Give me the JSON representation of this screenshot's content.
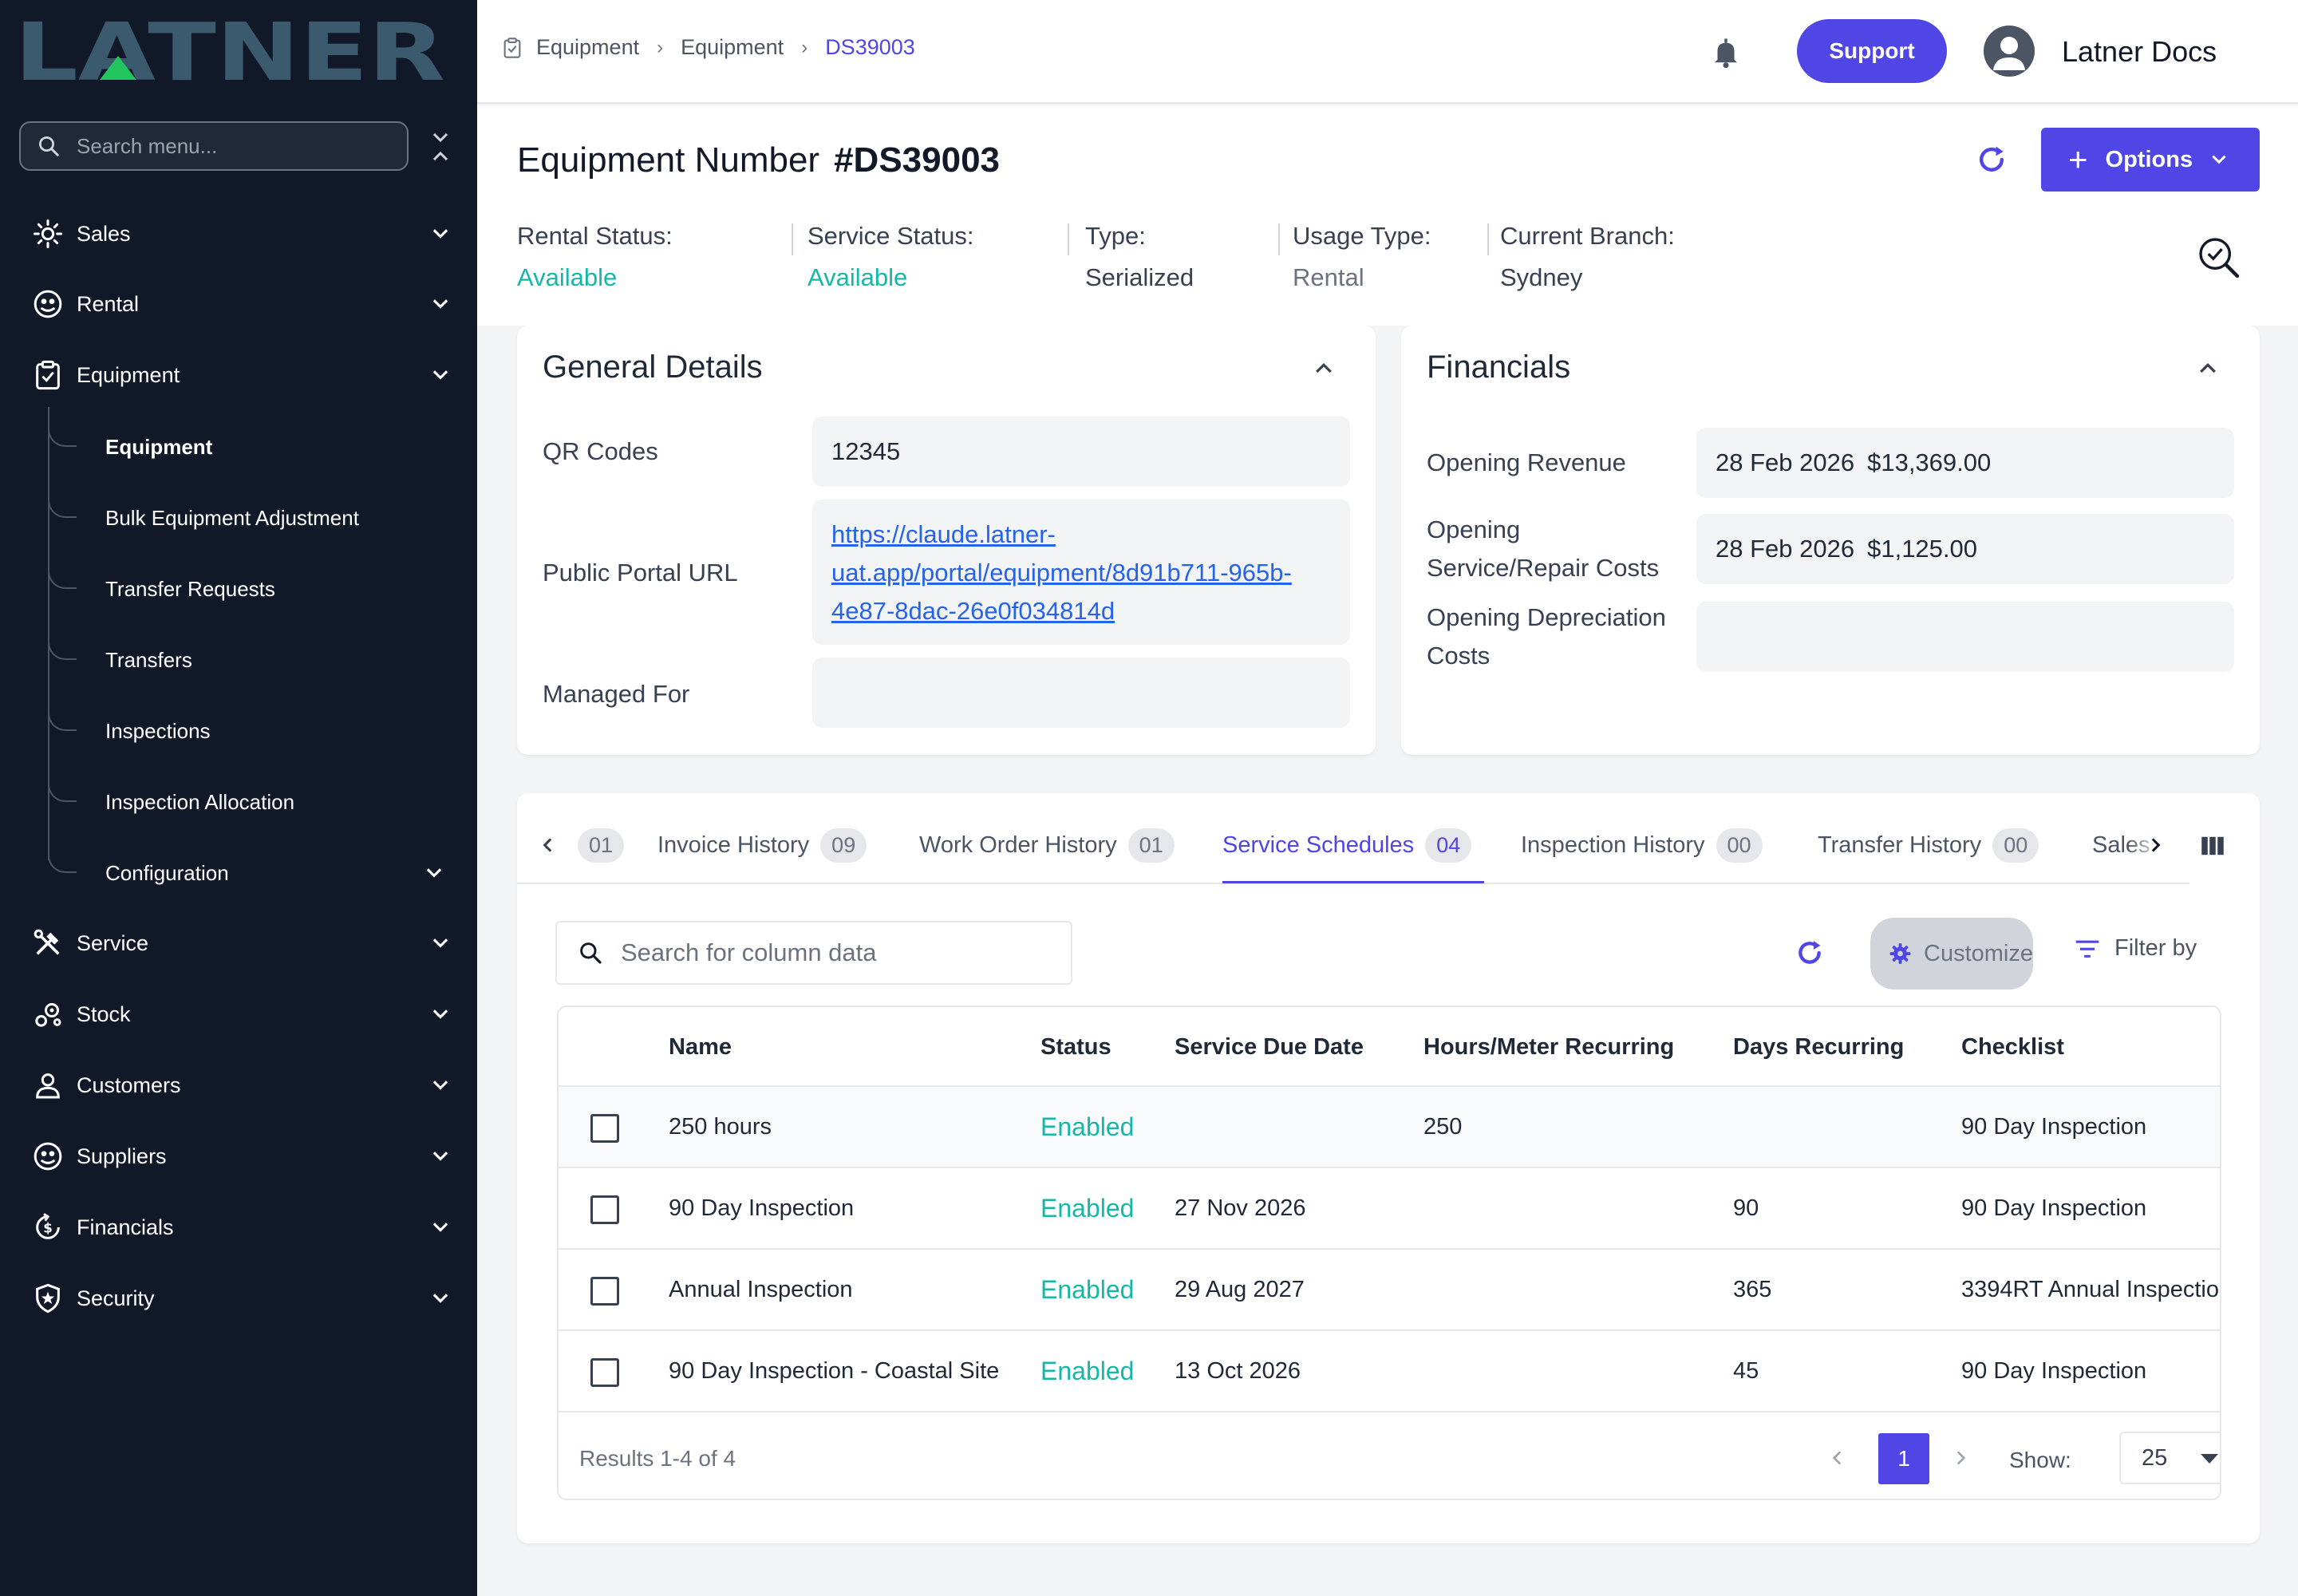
{
  "brand": {
    "logo_text": "LATNER"
  },
  "sidebar": {
    "search_placeholder": "Search menu...",
    "items": [
      {
        "label": "Sales",
        "icon": "sales-icon"
      },
      {
        "label": "Rental",
        "icon": "rental-icon"
      },
      {
        "label": "Equipment",
        "icon": "equipment-icon"
      },
      {
        "label": "Service",
        "icon": "service-icon"
      },
      {
        "label": "Stock",
        "icon": "stock-icon"
      },
      {
        "label": "Customers",
        "icon": "customers-icon"
      },
      {
        "label": "Suppliers",
        "icon": "suppliers-icon"
      },
      {
        "label": "Financials",
        "icon": "financials-icon"
      },
      {
        "label": "Security",
        "icon": "security-icon"
      }
    ],
    "equipment_sub": [
      {
        "label": "Equipment",
        "active": true
      },
      {
        "label": "Bulk Equipment Adjustment"
      },
      {
        "label": "Transfer Requests"
      },
      {
        "label": "Transfers"
      },
      {
        "label": "Inspections"
      },
      {
        "label": "Inspection Allocation"
      },
      {
        "label": "Configuration"
      }
    ]
  },
  "topbar": {
    "breadcrumb": [
      "Equipment",
      "Equipment",
      "DS39003"
    ],
    "support_label": "Support",
    "user_name": "Latner Docs"
  },
  "header": {
    "title_prefix": "Equipment Number",
    "equipment_number": "#DS39003",
    "options_label": "Options",
    "statuses": [
      {
        "label": "Rental Status:",
        "value": "Available",
        "color": "#14b8a6"
      },
      {
        "label": "Service Status:",
        "value": "Available",
        "color": "#14b8a6"
      },
      {
        "label": "Type:",
        "value": "Serialized",
        "color": "#374151"
      },
      {
        "label": "Usage Type:",
        "value": "Rental",
        "color": "#6b7280"
      },
      {
        "label": "Current Branch:",
        "value": "Sydney",
        "color": "#374151"
      }
    ]
  },
  "general": {
    "title": "General Details",
    "qr_label": "QR Codes",
    "qr_value": "12345",
    "portal_label": "Public Portal URL",
    "portal_url_lines": [
      "https://claude.latner-",
      "uat.app/portal/equipment/8d91b711-965b-",
      "4e87-8dac-26e0f034814d"
    ],
    "managed_label": "Managed For",
    "managed_value": ""
  },
  "financials": {
    "title": "Financials",
    "rows": [
      {
        "label_lines": [
          "Opening Revenue"
        ],
        "date": "28 Feb 2026",
        "amount": "$13,369.00"
      },
      {
        "label_lines": [
          "Opening",
          "Service/Repair Costs"
        ],
        "date": "28 Feb 2026",
        "amount": "$1,125.00"
      },
      {
        "label_lines": [
          "Opening Depreciation",
          "Costs"
        ],
        "date": "",
        "amount": ""
      }
    ]
  },
  "tabs": {
    "items": [
      {
        "label": "",
        "count": "01"
      },
      {
        "label": "Invoice History",
        "count": "09"
      },
      {
        "label": "Work Order History",
        "count": "01"
      },
      {
        "label": "Service Schedules",
        "count": "04",
        "active": true
      },
      {
        "label": "Inspection History",
        "count": "00"
      },
      {
        "label": "Transfer History",
        "count": "00"
      },
      {
        "label": "Sales",
        "count": ""
      }
    ]
  },
  "table": {
    "search_placeholder": "Search for column data",
    "customize_label": "Customize",
    "filter_label": "Filter by",
    "columns": [
      "Name",
      "Status",
      "Service Due Date",
      "Hours/Meter Recurring",
      "Days Recurring",
      "Checklist"
    ],
    "rows": [
      {
        "name": "250 hours",
        "status": "Enabled",
        "due": "",
        "hours": "250",
        "days": "",
        "checklist": "90 Day Inspection"
      },
      {
        "name": "90 Day Inspection",
        "status": "Enabled",
        "due": "27 Nov 2026",
        "hours": "",
        "days": "90",
        "checklist": "90 Day Inspection"
      },
      {
        "name": "Annual Inspection",
        "status": "Enabled",
        "due": "29 Aug 2027",
        "hours": "",
        "days": "365",
        "checklist": "3394RT Annual Inspectio"
      },
      {
        "name": "90 Day Inspection - Coastal Site",
        "status": "Enabled",
        "due": "13 Oct 2026",
        "hours": "",
        "days": "45",
        "checklist": "90 Day Inspection"
      }
    ],
    "results_text": "Results 1-4 of 4",
    "current_page": "1",
    "show_label": "Show:",
    "page_size": "25"
  },
  "colors": {
    "accent": "#4f46e5",
    "status_green": "#14b8a6",
    "sidebar_bg": "#111827"
  }
}
